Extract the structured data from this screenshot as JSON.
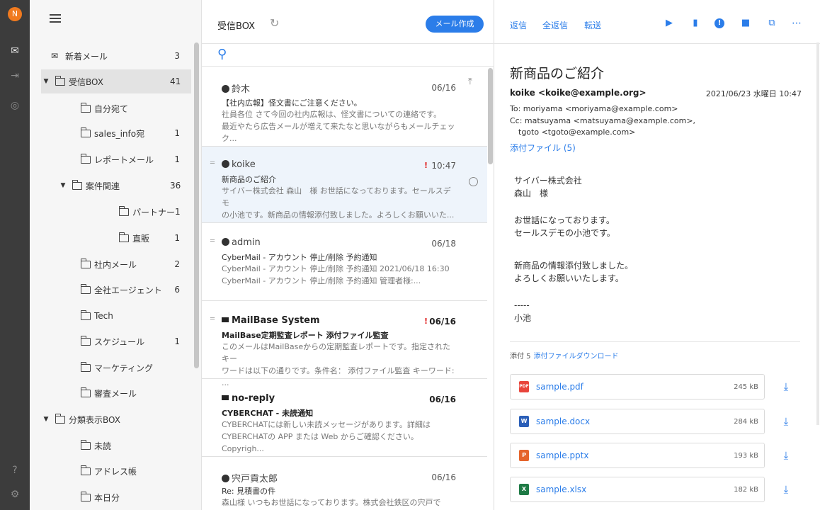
{
  "user": {
    "initial": "N"
  },
  "folders": [
    {
      "label": "新着メール",
      "count": "3"
    },
    {
      "label": "受信BOX",
      "count": "41"
    },
    {
      "label": "自分宛て",
      "count": ""
    },
    {
      "label": "sales_info宛",
      "count": "1"
    },
    {
      "label": "レポートメール",
      "count": "1"
    },
    {
      "label": "案件関連",
      "count": "36"
    },
    {
      "label": "パートナー",
      "count": "1"
    },
    {
      "label": "直販",
      "count": "1"
    },
    {
      "label": "社内メール",
      "count": "2"
    },
    {
      "label": "全社エージェント",
      "count": "6"
    },
    {
      "label": "Tech",
      "count": ""
    },
    {
      "label": "スケジュール",
      "count": "1"
    },
    {
      "label": "マーケティング",
      "count": ""
    },
    {
      "label": "審査メール",
      "count": ""
    },
    {
      "label": "分類表示BOX",
      "count": ""
    },
    {
      "label": "未読",
      "count": ""
    },
    {
      "label": "アドレス帳",
      "count": ""
    },
    {
      "label": "本日分",
      "count": ""
    }
  ],
  "list": {
    "title": "受信BOX",
    "compose_label": "メール作成",
    "messages": [
      {
        "sender": "鈴木",
        "date": "06/16",
        "subject": "【社内広報】怪文書にご注意ください。",
        "preview1": "社員各位 さて今回の社内広報は、怪文書についての連絡です。",
        "preview2": "最近やたら広告メールが増えて来たなと思いながらもメールチェック..."
      },
      {
        "sender": "koike",
        "flag": "!",
        "date": "10:47",
        "subject": "新商品のご紹介",
        "preview1": "サイバー株式会社 森山　様 お世話になっております。セールスデモ",
        "preview2": "の小池です。新商品の情報添付致しました。よろしくお願いいた..."
      },
      {
        "sender": "admin",
        "date": "06/18",
        "subject": "CyberMail - アカウント 停止/削除 予約通知",
        "preview1": "CyberMail - アカウント 停止/削除 予約通知 2021/06/18 16:30",
        "preview2": "CyberMail - アカウント 停止/削除 予約通知 管理者様:..."
      },
      {
        "sender": "MailBase System",
        "flag": "!",
        "date": "06/16",
        "subject": "MailBase定期監査レポート 添付ファイル監査",
        "preview1": "このメールはMailBaseからの定期監査レポートです。指定されたキー",
        "preview2": "ワードは以下の通りです。条件名： 添付ファイル監査 キーワード: ..."
      },
      {
        "sender": "no-reply",
        "date": "06/16",
        "subject": "CYBERCHAT - 未読通知",
        "preview1": "CYBERCHATには新しい未読メッセージがあります。詳細は",
        "preview2": "CYBERCHATの APP または Web からご確認ください。Copyrigh..."
      },
      {
        "sender": "宍戸貢太郎",
        "date": "06/16",
        "subject": "Re: 見積書の件",
        "preview1": "森山様 いつもお世話になっております。株式会社鉄区の宍戸で",
        "preview2": ""
      }
    ]
  },
  "toolbar": {
    "reply": "返信",
    "reply_all": "全返信",
    "forward": "転送"
  },
  "reader": {
    "subject": "新商品のご紹介",
    "from": "koike <koike@example.org>",
    "date": "2021/06/23 水曜日 10:47",
    "to": "To: moriyama <moriyama@example.com>",
    "cc1": "Cc: matsuyama <matsuyama@example.com>,",
    "cc2": "tgoto <tgoto@example.com>",
    "attach_link": "添付ファイル (5)",
    "body": [
      "サイバー株式会社",
      "森山　様",
      "お世話になっております。",
      "セールスデモの小池です。",
      "新商品の情報添付致しました。",
      "よろしくお願いいたします。",
      "-----",
      "小池"
    ],
    "attach_count": "添付 5",
    "attach_download": "添付ファイルダウンロード",
    "attachments": [
      {
        "name": "sample.pdf",
        "size": "245 kB",
        "type": "PDF",
        "color": "#e8453c"
      },
      {
        "name": "sample.docx",
        "size": "284 kB",
        "type": "W",
        "color": "#2b5fb8"
      },
      {
        "name": "sample.pptx",
        "size": "193 kB",
        "type": "P",
        "color": "#e5642b"
      },
      {
        "name": "sample.xlsx",
        "size": "182 kB",
        "type": "X",
        "color": "#1e7a45"
      }
    ]
  }
}
